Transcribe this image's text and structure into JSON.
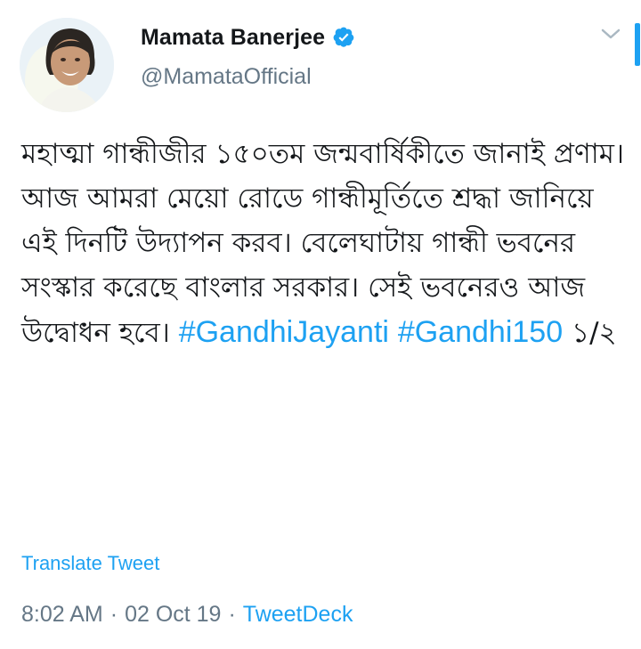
{
  "user": {
    "display_name": "Mamata Banerjee",
    "handle": "@MamataOfficial",
    "verified": true,
    "avatar": "profile-photo"
  },
  "tweet": {
    "segments": [
      {
        "type": "text",
        "text": "মহাত্মা গান্ধীজীর ১৫০তম জন্মবার্ষিকীতে জানাই প্রণাম। আজ আমরা মেয়ো রোডে গান্ধীমূর্তিতে শ্রদ্ধা জানিয়ে এই দিনটি উদ্যাপন করব। বেলেঘাটায় গান্ধী ভবনের সংস্কার করেছে বাংলার সরকার। সেই ভবনেরও আজ উদ্বোধন হবে। "
      },
      {
        "type": "hashtag",
        "text": "#GandhiJayanti"
      },
      {
        "type": "text",
        "text": " "
      },
      {
        "type": "hashtag",
        "text": "#Gandhi150"
      },
      {
        "type": "text",
        "text": " ১/২"
      }
    ],
    "translate_label": "Translate Tweet",
    "time": "8:02 AM",
    "separator": "·",
    "date": "02 Oct 19",
    "source": "TweetDeck"
  },
  "colors": {
    "link": "#1da1f2",
    "secondary": "#657786",
    "text": "#14171a"
  },
  "icons": {
    "verified": "verified-badge-icon",
    "menu": "chevron-down-icon"
  }
}
